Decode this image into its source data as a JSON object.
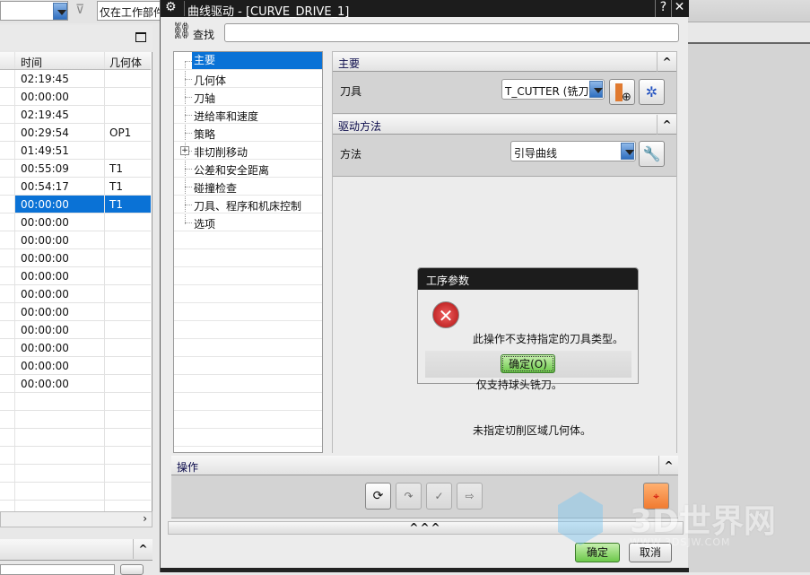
{
  "left_panel": {
    "filter_text": "仅在工作部件",
    "columns": [
      "时间",
      "几何体"
    ],
    "rows": [
      {
        "time": "02:19:45",
        "geom": ""
      },
      {
        "time": "00:00:00",
        "geom": ""
      },
      {
        "time": "02:19:45",
        "geom": ""
      },
      {
        "time": "00:29:54",
        "geom": "OP1"
      },
      {
        "time": "01:49:51",
        "geom": ""
      },
      {
        "time": "00:55:09",
        "geom": "T1"
      },
      {
        "time": "00:54:17",
        "geom": "T1"
      },
      {
        "time": "00:00:00",
        "geom": "T1",
        "selected": true
      },
      {
        "time": "00:00:00",
        "geom": ""
      },
      {
        "time": "00:00:00",
        "geom": ""
      },
      {
        "time": "00:00:00",
        "geom": ""
      },
      {
        "time": "00:00:00",
        "geom": ""
      },
      {
        "time": "00:00:00",
        "geom": ""
      },
      {
        "time": "00:00:00",
        "geom": ""
      },
      {
        "time": "00:00:00",
        "geom": ""
      },
      {
        "time": "00:00:00",
        "geom": ""
      },
      {
        "time": "00:00:00",
        "geom": ""
      },
      {
        "time": "00:00:00",
        "geom": ""
      }
    ],
    "scroll_right": "›",
    "collapse": "^"
  },
  "dialog": {
    "title": "曲线驱动 - [CURVE_DRIVE_1]",
    "help": "?",
    "close": "✕",
    "find_label": "查找",
    "find_value": "",
    "tree": [
      "主要",
      "几何体",
      "刀轴",
      "进给率和速度",
      "策略",
      "非切削移动",
      "公差和安全距离",
      "碰撞检查",
      "刀具、程序和机床控制",
      "选项"
    ],
    "tree_selected": 0,
    "tree_expandable": 5,
    "sections": {
      "main": {
        "title": "主要",
        "tool_label": "刀具",
        "tool_value": "T_CUTTER (铣刀·"
      },
      "drive": {
        "title": "驱动方法",
        "method_label": "方法",
        "method_value": "引导曲线"
      },
      "ops": {
        "title": "操作"
      }
    },
    "expand": "^^^",
    "ok": "确定",
    "cancel": "取消"
  },
  "popup": {
    "title": "工序参数",
    "lines": [
      "此操作不支持指定的刀具类型。",
      " 仅支持球头铣刀。",
      "未指定切削区域几何体。"
    ],
    "ok": "确定(O)"
  },
  "watermark": {
    "logo": "3D世界网",
    "url": "WWW.3DSJW.COM"
  },
  "colors": {
    "selection": "#0a72d6",
    "title_bar": "#1c1c1c",
    "ok_green": "#6cc84a"
  }
}
